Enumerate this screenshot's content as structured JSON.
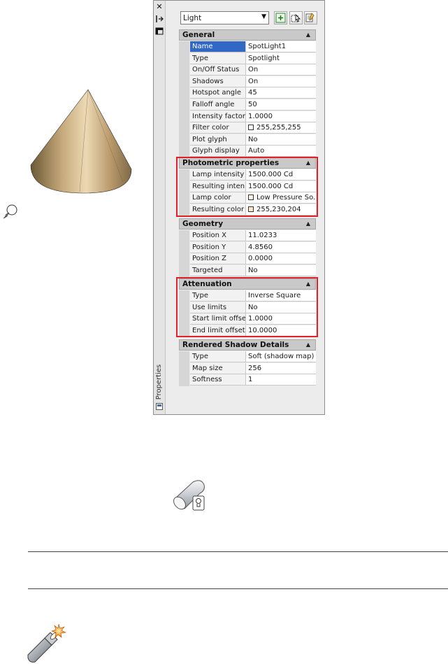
{
  "palette": {
    "title": "Properties",
    "object_type": "Light"
  },
  "sections": [
    {
      "header": "General",
      "rows": [
        {
          "label": "Name",
          "value": "SpotLight1"
        },
        {
          "label": "Type",
          "value": "Spotlight"
        },
        {
          "label": "On/Off Status",
          "value": "On"
        },
        {
          "label": "Shadows",
          "value": "On"
        },
        {
          "label": "Hotspot angle",
          "value": "45"
        },
        {
          "label": "Falloff angle",
          "value": "50"
        },
        {
          "label": "Intensity factor",
          "value": "1.0000"
        },
        {
          "label": "Filter color",
          "value": "255,255,255",
          "swatch": "#ffffff"
        },
        {
          "label": "Plot glyph",
          "value": "No"
        },
        {
          "label": "Glyph display",
          "value": "Auto"
        }
      ]
    },
    {
      "header": "Photometric properties",
      "rows": [
        {
          "label": "Lamp intensity",
          "value": "1500.000 Cd"
        },
        {
          "label": "Resulting inten...",
          "value": "1500.000 Cd"
        },
        {
          "label": "Lamp color",
          "value": "Low Pressure So...",
          "swatch": "#fff6e8"
        },
        {
          "label": "Resulting color",
          "value": "255,230,204",
          "swatch": "#ffe6cc"
        }
      ]
    },
    {
      "header": "Geometry",
      "rows": [
        {
          "label": "Position X",
          "value": "11.0233"
        },
        {
          "label": "Position Y",
          "value": "4.8560"
        },
        {
          "label": "Position Z",
          "value": "0.0000"
        },
        {
          "label": "Targeted",
          "value": "No"
        }
      ]
    },
    {
      "header": "Attenuation",
      "rows": [
        {
          "label": "Type",
          "value": "Inverse Square"
        },
        {
          "label": "Use limits",
          "value": "No"
        },
        {
          "label": "Start limit offset",
          "value": "1.0000"
        },
        {
          "label": "End limit offset",
          "value": "10.0000"
        }
      ]
    },
    {
      "header": "Rendered Shadow Details",
      "rows": [
        {
          "label": "Type",
          "value": "Soft (shadow map)"
        },
        {
          "label": "Map size",
          "value": "256"
        },
        {
          "label": "Softness",
          "value": "1"
        }
      ]
    }
  ],
  "colors": {
    "highlight": "#e0202a",
    "selection": "#3168c5",
    "cone": "#c8a878"
  },
  "icons": [
    "close-icon",
    "autohide-icon",
    "properties-menu-icon",
    "quick-select-icon",
    "select-objects-icon",
    "pickadd-icon",
    "bulb-icon",
    "spotlight-cylinder-icon",
    "flashlight-icon"
  ]
}
